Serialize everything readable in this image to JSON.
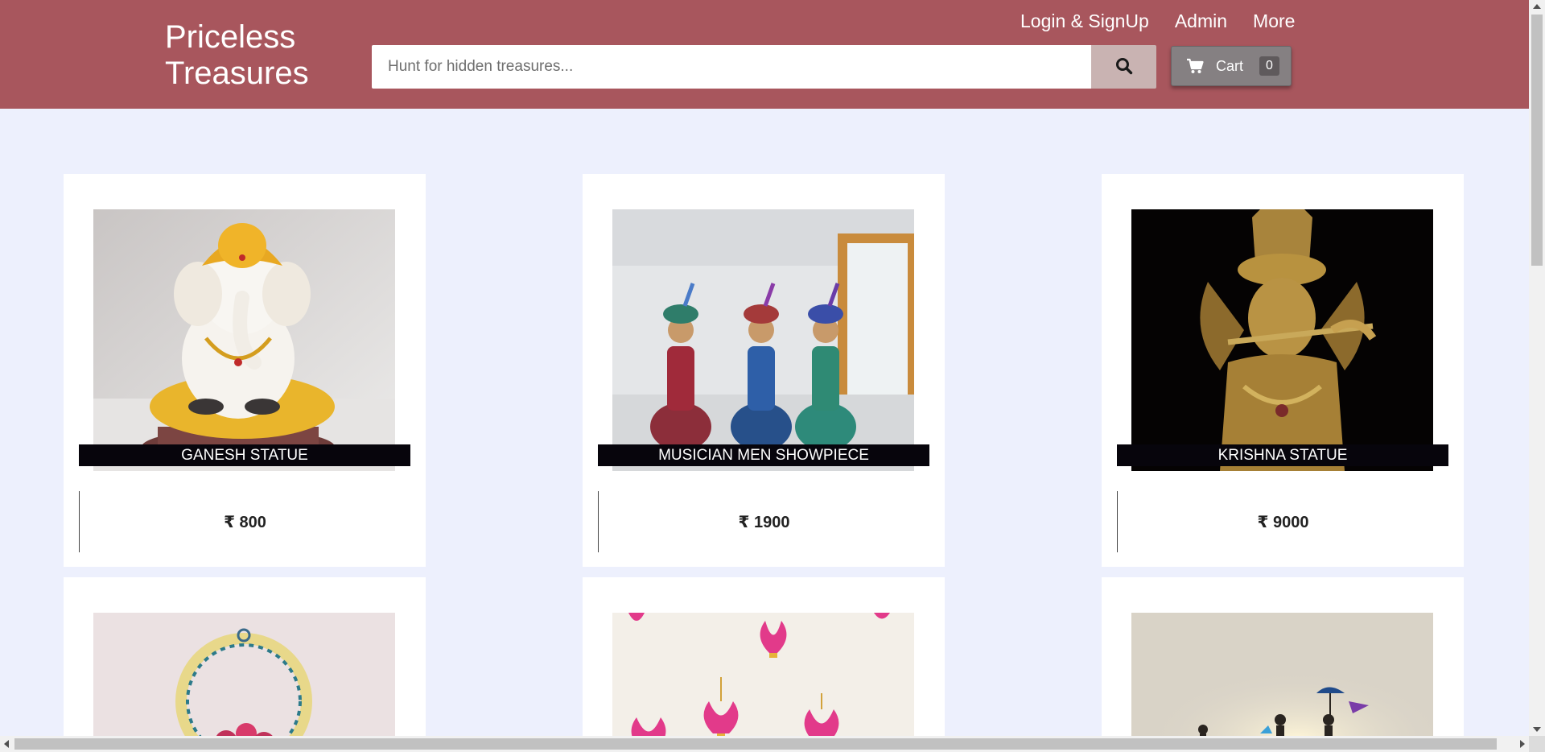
{
  "header": {
    "brand_line1": "Priceless",
    "brand_line2": "Treasures",
    "search_placeholder": "Hunt for hidden treasures...",
    "nav": [
      "Login & SignUp",
      "Admin",
      "More"
    ],
    "cart_label": "Cart",
    "cart_count": "0",
    "colors": {
      "header_bg": "#a8565d",
      "page_bg": "#edf0fd",
      "search_btn": "#c9b3b2",
      "cart_btn": "#858082"
    }
  },
  "products": [
    {
      "name": "GANESH STATUE",
      "price": "₹ 800",
      "image": "ganesh-statue-image"
    },
    {
      "name": "MUSICIAN MEN SHOWPIECE",
      "price": "₹ 1900",
      "image": "musician-men-image"
    },
    {
      "name": "KRISHNA STATUE",
      "price": "₹ 9000",
      "image": "krishna-statue-image"
    },
    {
      "name": "",
      "price": "",
      "image": "peacock-wall-hanging-image"
    },
    {
      "name": "",
      "price": "",
      "image": "lotus-decor-image"
    },
    {
      "name": "",
      "price": "",
      "image": "figurines-image"
    }
  ]
}
